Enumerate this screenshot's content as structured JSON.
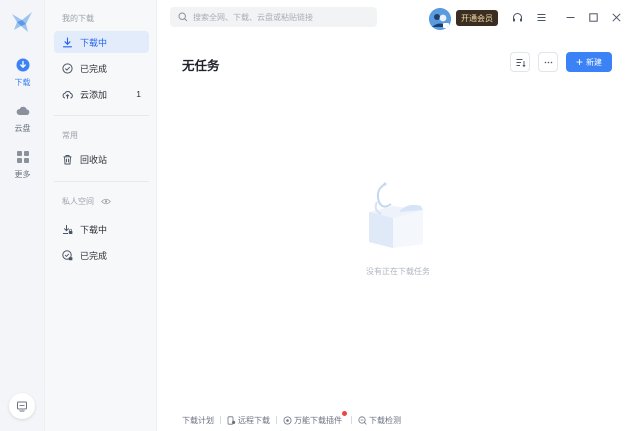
{
  "rail": {
    "items": [
      {
        "label": "下载"
      },
      {
        "label": "云盘"
      },
      {
        "label": "更多"
      }
    ]
  },
  "sidebar": {
    "my_downloads_title": "我的下载",
    "items": [
      {
        "label": "下载中"
      },
      {
        "label": "已完成"
      },
      {
        "label": "云添加",
        "count": "1"
      }
    ],
    "common_title": "常用",
    "common_items": [
      {
        "label": "回收站"
      }
    ],
    "private_title": "私人空间",
    "private_items": [
      {
        "label": "下载中"
      },
      {
        "label": "已完成"
      }
    ]
  },
  "header": {
    "search_placeholder": "搜索全网、下载、云盘或粘贴链接",
    "vip_label": "开通会员"
  },
  "main": {
    "title": "无任务",
    "new_label": "新建",
    "empty_text": "没有正在下载任务"
  },
  "footer": {
    "links": [
      {
        "label": "下载计划"
      },
      {
        "label": "远程下载"
      },
      {
        "label": "万能下载插件"
      },
      {
        "label": "下载检测"
      }
    ]
  },
  "colors": {
    "accent": "#3b82f6",
    "active_bg": "#e3ecfb",
    "vip_bg": "#3a2e22",
    "vip_text": "#f3d9a4",
    "badge": "#ef4444"
  }
}
